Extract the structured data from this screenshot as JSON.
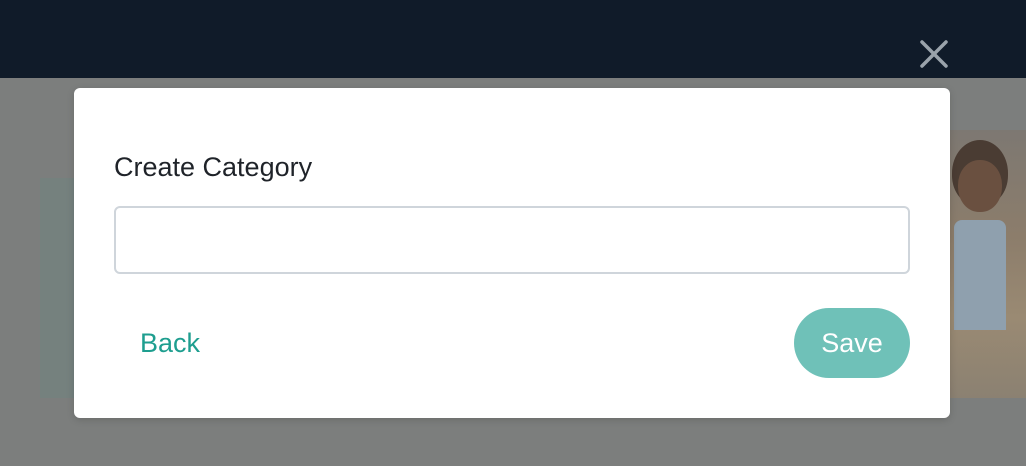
{
  "header": {
    "close_icon": "close-icon"
  },
  "modal": {
    "title": "Create Category",
    "input_value": "",
    "input_placeholder": "",
    "back_label": "Back",
    "save_label": "Save"
  },
  "colors": {
    "accent": "#1e9e8f",
    "save_button": "#6fc1b8",
    "header_bg": "#101b29",
    "overlay": "#7c7e7d"
  }
}
